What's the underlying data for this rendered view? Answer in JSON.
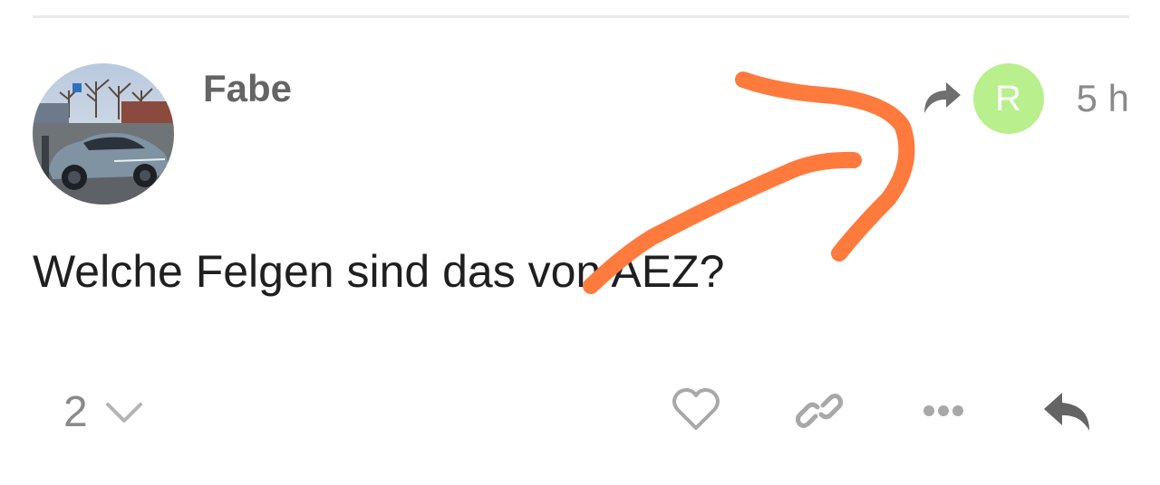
{
  "post": {
    "author": "Fabe",
    "time": "5 h",
    "body": "Welche Felgen sind das von AEZ?",
    "reply_to_avatar_letter": "R",
    "reply_to_avatar_color": "#b9ef8c"
  },
  "footer": {
    "reply_count": "2"
  },
  "icons": {
    "share": "share-arrow-icon",
    "like": "heart-icon",
    "link": "link-icon",
    "more": "ellipsis-icon",
    "reply": "reply-arrow-icon",
    "expand": "chevron-down-icon"
  },
  "colors": {
    "annotation": "#ff7a3d",
    "icon_gray": "#8a8a8a",
    "text_dark": "#1f1f1f"
  }
}
